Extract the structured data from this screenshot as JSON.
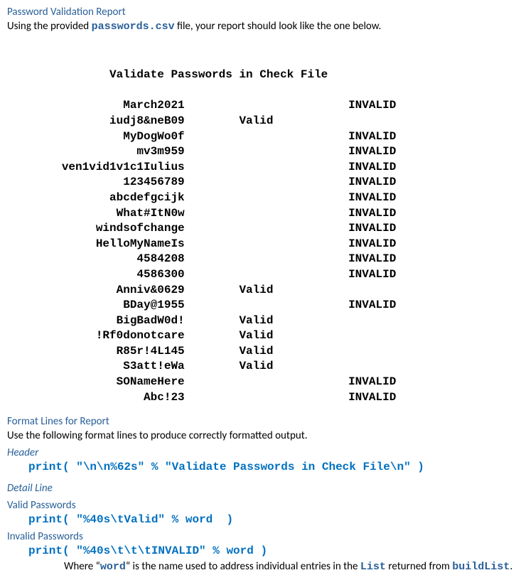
{
  "section1": {
    "heading": "Password Validation Report",
    "intro_pre": "Using the provided ",
    "intro_file": "passwords.csv",
    "intro_post": " file, your report should look like the one below."
  },
  "report": {
    "title": "Validate Passwords in Check File",
    "entries": [
      {
        "password": "March2021",
        "status": "INVALID"
      },
      {
        "password": "iudj8&neB09",
        "status": "Valid"
      },
      {
        "password": "MyDogWo0f",
        "status": "INVALID"
      },
      {
        "password": "mv3m959",
        "status": "INVALID"
      },
      {
        "password": "ven1vid1v1c1Iulius",
        "status": "INVALID"
      },
      {
        "password": "123456789",
        "status": "INVALID"
      },
      {
        "password": "abcdefgcijk",
        "status": "INVALID"
      },
      {
        "password": "What#ItN0w",
        "status": "INVALID"
      },
      {
        "password": "windsofchange",
        "status": "INVALID"
      },
      {
        "password": "HelloMyNameIs",
        "status": "INVALID"
      },
      {
        "password": "4584208",
        "status": "INVALID"
      },
      {
        "password": "4586300",
        "status": "INVALID"
      },
      {
        "password": "Anniv&0629",
        "status": "Valid"
      },
      {
        "password": "BDay@1955",
        "status": "INVALID"
      },
      {
        "password": "BigBadW0d!",
        "status": "Valid"
      },
      {
        "password": "!Rf0donotcare",
        "status": "Valid"
      },
      {
        "password": "R85r!4L145",
        "status": "Valid"
      },
      {
        "password": "S3att!eWa",
        "status": "Valid"
      },
      {
        "password": "SONameHere",
        "status": "INVALID"
      },
      {
        "password": "Abc!23",
        "status": "INVALID"
      }
    ]
  },
  "section2": {
    "heading": "Format Lines for Report",
    "subtext": "Use the following format lines to produce correctly formatted output.",
    "header_label": "Header",
    "header_code": "print( \"\\n\\n%62s\" % \"Validate Passwords in Check File\\n\" )",
    "detail_label": "Detail Line",
    "valid_label": "Valid Passwords",
    "valid_code": "print( \"%40s\\tValid\" % word  )",
    "invalid_label": "Invalid Passwords",
    "invalid_code": "print( \"%40s\\t\\t\\tINVALID\" % word )",
    "where_pre": "Where “",
    "where_word": "word",
    "where_mid": "“ is the name used to address individual entries in the ",
    "where_list": "List",
    "where_ret": " returned from ",
    "where_fn": "buildList",
    "where_end": "."
  },
  "chart_data": [
    {
      "password": "March2021",
      "status": "INVALID"
    },
    {
      "password": "iudj8&neB09",
      "status": "Valid"
    },
    {
      "password": "MyDogWo0f",
      "status": "INVALID"
    },
    {
      "password": "mv3m959",
      "status": "INVALID"
    },
    {
      "password": "ven1vid1v1c1Iulius",
      "status": "INVALID"
    },
    {
      "password": "123456789",
      "status": "INVALID"
    },
    {
      "password": "abcdefgcijk",
      "status": "INVALID"
    },
    {
      "password": "What#ItN0w",
      "status": "INVALID"
    },
    {
      "password": "windsofchange",
      "status": "INVALID"
    },
    {
      "password": "HelloMyNameIs",
      "status": "INVALID"
    },
    {
      "password": "4584208",
      "status": "INVALID"
    },
    {
      "password": "4586300",
      "status": "INVALID"
    },
    {
      "password": "Anniv&0629",
      "status": "Valid"
    },
    {
      "password": "BDay@1955",
      "status": "INVALID"
    },
    {
      "password": "BigBadW0d!",
      "status": "Valid"
    },
    {
      "password": "!Rf0donotcare",
      "status": "Valid"
    },
    {
      "password": "R85r!4L145",
      "status": "Valid"
    },
    {
      "password": "S3att!eWa",
      "status": "Valid"
    },
    {
      "password": "SONameHere",
      "status": "INVALID"
    },
    {
      "password": "Abc!23",
      "status": "INVALID"
    }
  ]
}
